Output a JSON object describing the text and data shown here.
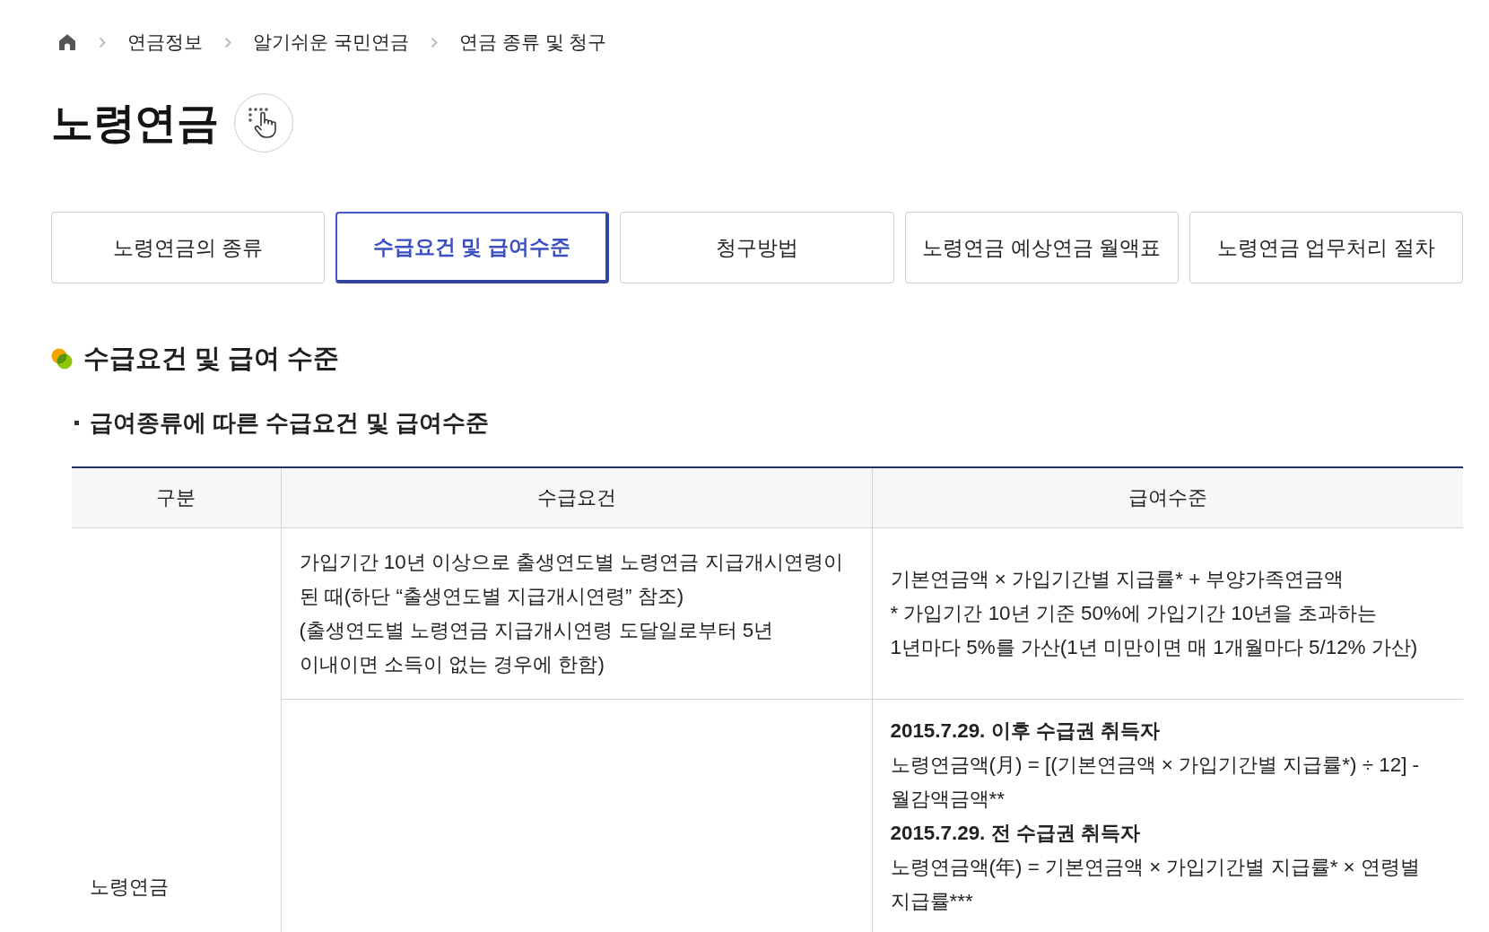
{
  "breadcrumb": {
    "items": [
      "연금정보",
      "알기쉬운 국민연금",
      "연금 종류 및 청구"
    ]
  },
  "page_title": "노령연금",
  "tabs": [
    {
      "label": "노령연금의 종류",
      "selected": false
    },
    {
      "label": "수급요건 및 급여수준",
      "selected": true
    },
    {
      "label": "청구방법",
      "selected": false
    },
    {
      "label": "노령연금 예상연금 월액표",
      "selected": false
    },
    {
      "label": "노령연금 업무처리 절차",
      "selected": false
    }
  ],
  "section": {
    "heading": "수급요건 및 급여 수준",
    "subheading": "급여종류에 따른 수급요건 및 급여수준"
  },
  "table": {
    "columns": [
      "구분",
      "수급요건",
      "급여수준"
    ],
    "group_label": "노령연금",
    "rows": [
      {
        "requirement": [
          "가입기간 10년 이상으로 출생연도별 노령연금 지급개시연령이 된 때(하단 “출생연도별 지급개시연령” 참조)",
          "(출생연도별 노령연금 지급개시연령 도달일로부터 5년 이내이면 소득이 없는 경우에 한함)"
        ],
        "benefit": [
          {
            "kind": "text",
            "text": "기본연금액 × 가입기간별 지급률* + 부양가족연금액"
          },
          {
            "kind": "text",
            "text": "* 가입기간 10년 기준 50%에 가입기간 10년을 초과하는 1년마다 5%를 가산(1년 미만이면 매 1개월마다 5/12% 가산)"
          }
        ]
      },
      {
        "benefit": [
          {
            "kind": "heading",
            "text": "2015.7.29. 이후 수급권 취득자"
          },
          {
            "kind": "text",
            "text": "노령연금액(月) = [(기본연금액 × 가입기간별 지급률*) ÷ 12] - 월감액금액**"
          },
          {
            "kind": "heading",
            "text": "2015.7.29. 전 수급권 취득자"
          },
          {
            "kind": "text",
            "text": "노령연금액(年) = 기본연금액 × 가입기간별 지급률* × 연령별 지급률***"
          }
        ]
      }
    ]
  }
}
